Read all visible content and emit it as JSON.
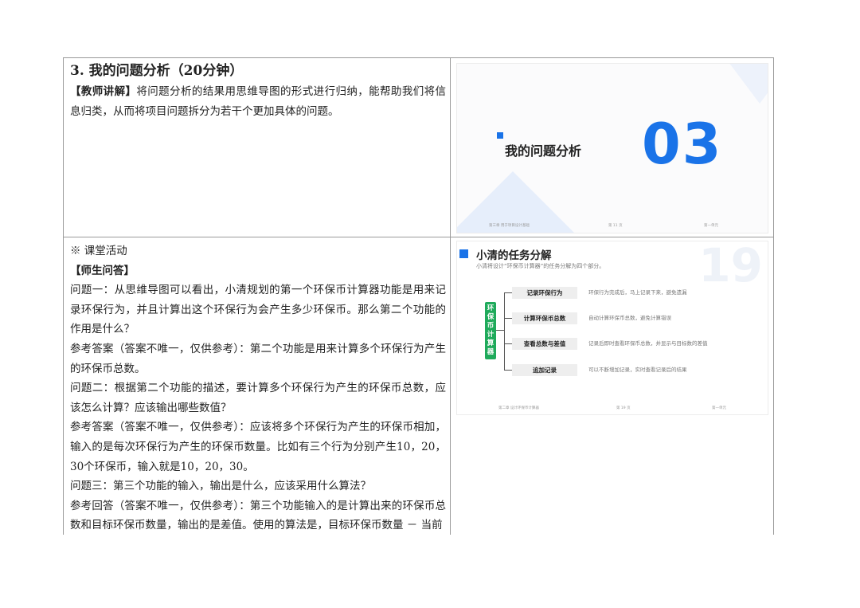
{
  "section1": {
    "heading": "3. 我的问题分析（20分钟）",
    "teacher_tag": "【教师讲解】",
    "teacher_text": "将问题分析的结果用思维导图的形式进行归纳，能帮助我们将信息归类，从而将项目问题拆分为若干个更加具体的问题。"
  },
  "section2": {
    "activity": "※ 课堂活动",
    "qa_tag": "【师生问答】",
    "paragraphs": [
      "问题一：从思维导图可以看出，小清规划的第一个环保币计算器功能是用来记录环保行为，并且计算出这个环保行为会产生多少环保币。那么第二个功能的作用是什么？",
      "参考答案（答案不唯一，仅供参考）：第二个功能是用来计算多个环保行为产生的环保币总数。",
      "问题二：根据第二个功能的描述，要计算多个环保行为产生的环保币总数，应该怎么计算？应该输出哪些数值？",
      "参考答案（答案不唯一，仅供参考）：应该将多个环保行为产生的环保币相加，输入的是每次环保行为产生的环保币数量。比如有三个行为分别产生10，20，30个环保币，输入就是10，20，30。",
      "问题三：第三个功能的输入，输出是什么，应该采用什么算法？",
      "参考回答（答案不唯一，仅供参考）：第三个功能输入的是计算出来的环保币总数和目标环保币数量，输出的是差值。使用的算法是，目标环保币数量 － 当前"
    ]
  },
  "slide1": {
    "title": "我的问题分析",
    "number": "03",
    "footer_left": "第三章 用于项目设计基础",
    "footer_mid": "第 11 页",
    "footer_right": "第一单元"
  },
  "slide2": {
    "bg_number": "19",
    "title": "小清的任务分解",
    "subtitle": "小清将设计“环保币计算器”的任务分解为四个部分。",
    "root": "环保币计算器",
    "nodes": [
      {
        "label": "记录环保行为",
        "desc": "环保行为完成后，马上记录下来，避免遗漏"
      },
      {
        "label": "计算环保币总数",
        "desc": "自动计算环保币总数，避免计算错误"
      },
      {
        "label": "查看总数与差值",
        "desc": "记录后即时查看环保币总数，并显示与目标数的差值"
      },
      {
        "label": "追加记录",
        "desc": "可以不断增加记录，实时查看记录后的结果"
      }
    ],
    "footer_left": "第二章 设计环保币计算器",
    "footer_mid": "第 19 页",
    "footer_right": "第一单元"
  }
}
